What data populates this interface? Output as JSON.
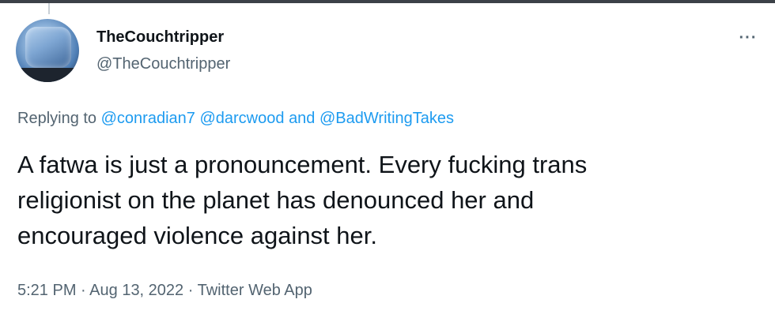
{
  "tweet": {
    "author": {
      "display_name": "TheCouchtripper",
      "handle": "@TheCouchtripper"
    },
    "more_icon": "more-options-icon",
    "more_glyph": "···",
    "reply_context": {
      "prefix": "Replying to",
      "mention_1": "@conradian7",
      "mention_2": "@darcwood",
      "conjunction": "and",
      "mention_3": "@BadWritingTakes"
    },
    "text_lines": [
      "A fatwa is just a pronouncement. Every fucking trans",
      "religionist on the planet has denounced her and",
      "encouraged violence against her."
    ],
    "time": "5:21 PM",
    "separator": "·",
    "date": "Aug 13, 2022",
    "source": "Twitter Web App"
  },
  "colors": {
    "primary_text": "#0f1419",
    "secondary_text": "#536471",
    "link": "#1d9bf0"
  }
}
